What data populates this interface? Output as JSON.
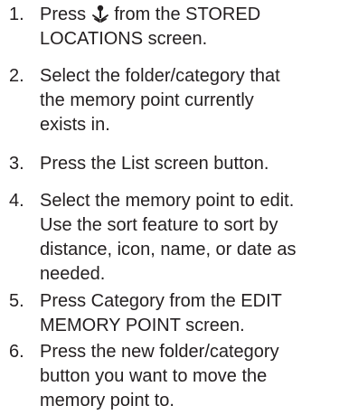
{
  "steps": [
    {
      "number": "1.",
      "lines": [
        "Press",
        "from the STORED",
        "LOCATIONS screen."
      ],
      "icon": "memory-point-icon"
    },
    {
      "number": "2.",
      "lines": [
        "Select the folder/category that",
        "the memory point currently",
        "exists in."
      ]
    },
    {
      "number": "3.",
      "lines": [
        "Press the List screen button."
      ]
    },
    {
      "number": "4.",
      "lines": [
        "Select the memory point to edit.",
        "Use the sort feature to sort by",
        "distance, icon, name, or date as",
        "needed."
      ]
    },
    {
      "number": "5.",
      "lines": [
        "Press Category from the EDIT",
        "MEMORY POINT screen."
      ]
    },
    {
      "number": "6.",
      "lines": [
        "Press the new folder/category",
        "button you want to move the",
        "memory point to."
      ]
    }
  ]
}
